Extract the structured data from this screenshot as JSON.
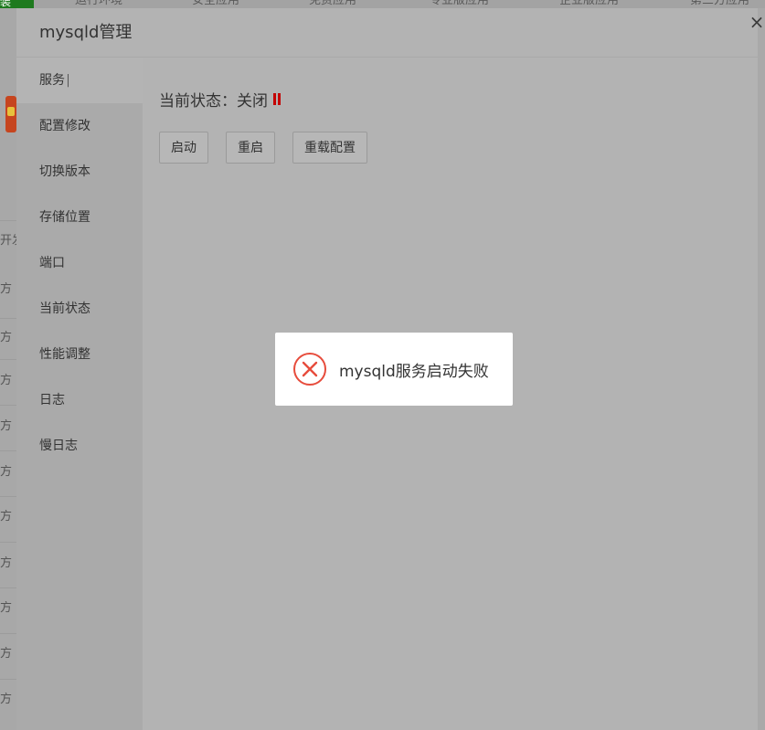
{
  "background": {
    "tabs": [
      "运行环境",
      "安全应用",
      "免费应用",
      "专业版应用",
      "企业版应用",
      "第三方应用"
    ],
    "green_label": "装",
    "strip_labels": [
      "开发",
      "方",
      "方",
      "方",
      "方",
      "方",
      "方",
      "方",
      "方",
      "方",
      "方"
    ]
  },
  "modal": {
    "title": "mysqld管理",
    "nav": [
      {
        "label": "服务",
        "active": true
      },
      {
        "label": "配置修改"
      },
      {
        "label": "切换版本"
      },
      {
        "label": "存储位置"
      },
      {
        "label": "端口"
      },
      {
        "label": "当前状态"
      },
      {
        "label": "性能调整"
      },
      {
        "label": "日志"
      },
      {
        "label": "慢日志"
      }
    ],
    "status_label": "当前状态：关闭",
    "buttons": {
      "start": "启动",
      "restart": "重启",
      "reload": "重载配置"
    }
  },
  "toast": {
    "message": "mysqld服务启动失败",
    "icon": "error-circle-icon"
  },
  "colors": {
    "status_stopped": "#c40000",
    "error_icon": "#e74c3c"
  }
}
